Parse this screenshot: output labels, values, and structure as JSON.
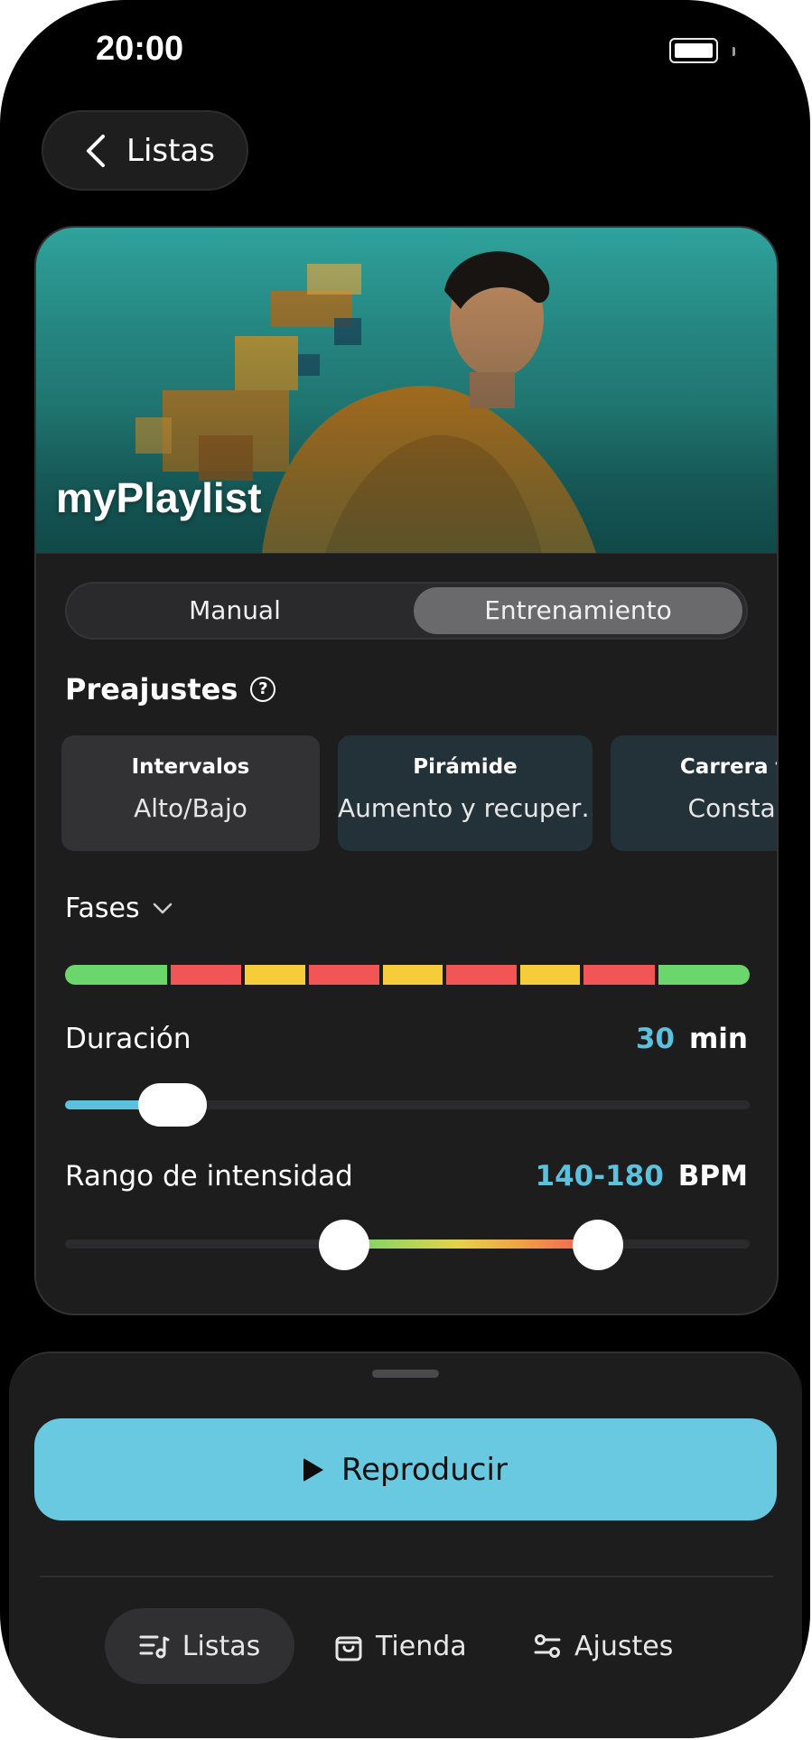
{
  "status_bar": {
    "time": "20:00"
  },
  "header": {
    "back_label": "Listas"
  },
  "playlist": {
    "title": "myPlaylist"
  },
  "mode_toggle": {
    "options": [
      "Manual",
      "Entrenamiento"
    ],
    "selected": "Entrenamiento"
  },
  "presets": {
    "title": "Preajustes",
    "items": [
      {
        "name": "Intervalos",
        "description": "Alto/Bajo"
      },
      {
        "name": "Pirámide",
        "description": "Aumento y recuper…"
      },
      {
        "name": "Carrera te",
        "description": "Constan"
      }
    ]
  },
  "phases": {
    "label": "Fases",
    "segments": [
      {
        "color": "#6bd66b",
        "weight": 1.45
      },
      {
        "color": "#f25555",
        "weight": 1.0
      },
      {
        "color": "#f7cc3a",
        "weight": 0.85
      },
      {
        "color": "#f25555",
        "weight": 1.0
      },
      {
        "color": "#f7cc3a",
        "weight": 0.85
      },
      {
        "color": "#f25555",
        "weight": 1.0
      },
      {
        "color": "#f7cc3a",
        "weight": 0.85
      },
      {
        "color": "#f25555",
        "weight": 1.0
      },
      {
        "color": "#6bd66b",
        "weight": 1.3
      }
    ]
  },
  "duration": {
    "label": "Duración",
    "value": "30",
    "unit": "min",
    "fraction": 0.157
  },
  "intensity": {
    "label": "Rango de intensidad",
    "value": "140-180",
    "unit": "BPM",
    "low_fraction": 0.408,
    "high_fraction": 0.778
  },
  "player": {
    "play_label": "Reproducir"
  },
  "bottom_nav": {
    "items": [
      {
        "label": "Listas",
        "active": true
      },
      {
        "label": "Tienda"
      },
      {
        "label": "Ajustes"
      }
    ]
  },
  "colors": {
    "accent": "#5bc1dc",
    "play_button": "#68c9e0"
  }
}
